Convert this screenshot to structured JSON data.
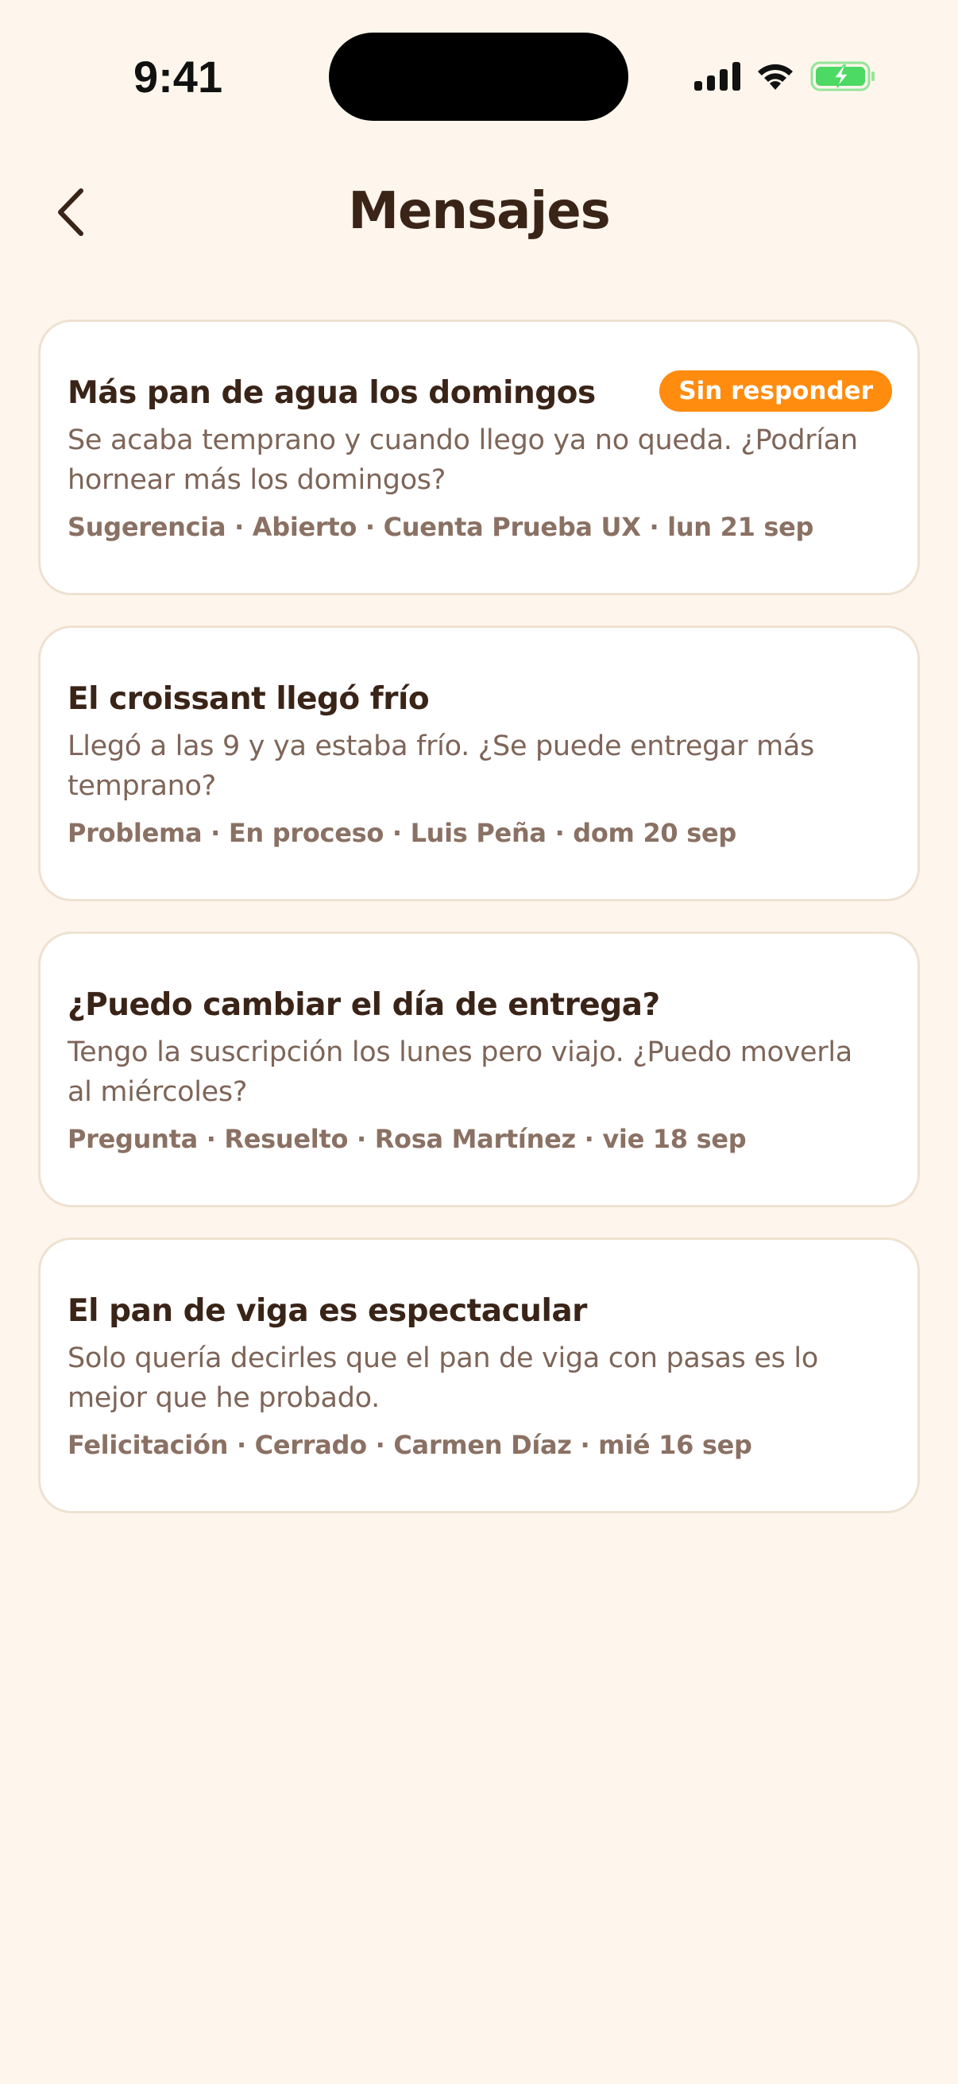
{
  "status_bar": {
    "time": "9:41",
    "icons": [
      "cellular-signal-icon",
      "wifi-icon",
      "battery-charging-icon"
    ],
    "battery_color": "#4CD964"
  },
  "header": {
    "title": "Mensajes",
    "back_icon": "chevron-left-icon"
  },
  "colors": {
    "background": "#FEF6EC",
    "card": "#FFFFFF",
    "card_border": "#EFE1D1",
    "title_text": "#3A2418",
    "secondary_text": "#7E6558",
    "accent_badge": "#FF8C0F"
  },
  "messages": [
    {
      "title": "Más pan de agua los domingos",
      "preview": "Se acaba temprano y cuando llego ya no queda. ¿Podrían hornear más los domingos?",
      "meta": "Sugerencia · Abierto · Cuenta Prueba UX · lun 21 sep",
      "badge": "Sin responder"
    },
    {
      "title": "El croissant llegó frío",
      "preview": "Llegó a las 9 y ya estaba frío. ¿Se puede entregar más temprano?",
      "meta": "Problema · En proceso · Luis Peña · dom 20 sep"
    },
    {
      "title": "¿Puedo cambiar el día de entrega?",
      "preview": "Tengo la suscripción los lunes pero viajo. ¿Puedo moverla al miércoles?",
      "meta": "Pregunta · Resuelto · Rosa Martínez · vie 18 sep"
    },
    {
      "title": "El pan de viga es espectacular",
      "preview": "Solo quería decirles que el pan de viga con pasas es lo mejor que he probado.",
      "meta": "Felicitación · Cerrado · Carmen Díaz · mié 16 sep"
    }
  ]
}
